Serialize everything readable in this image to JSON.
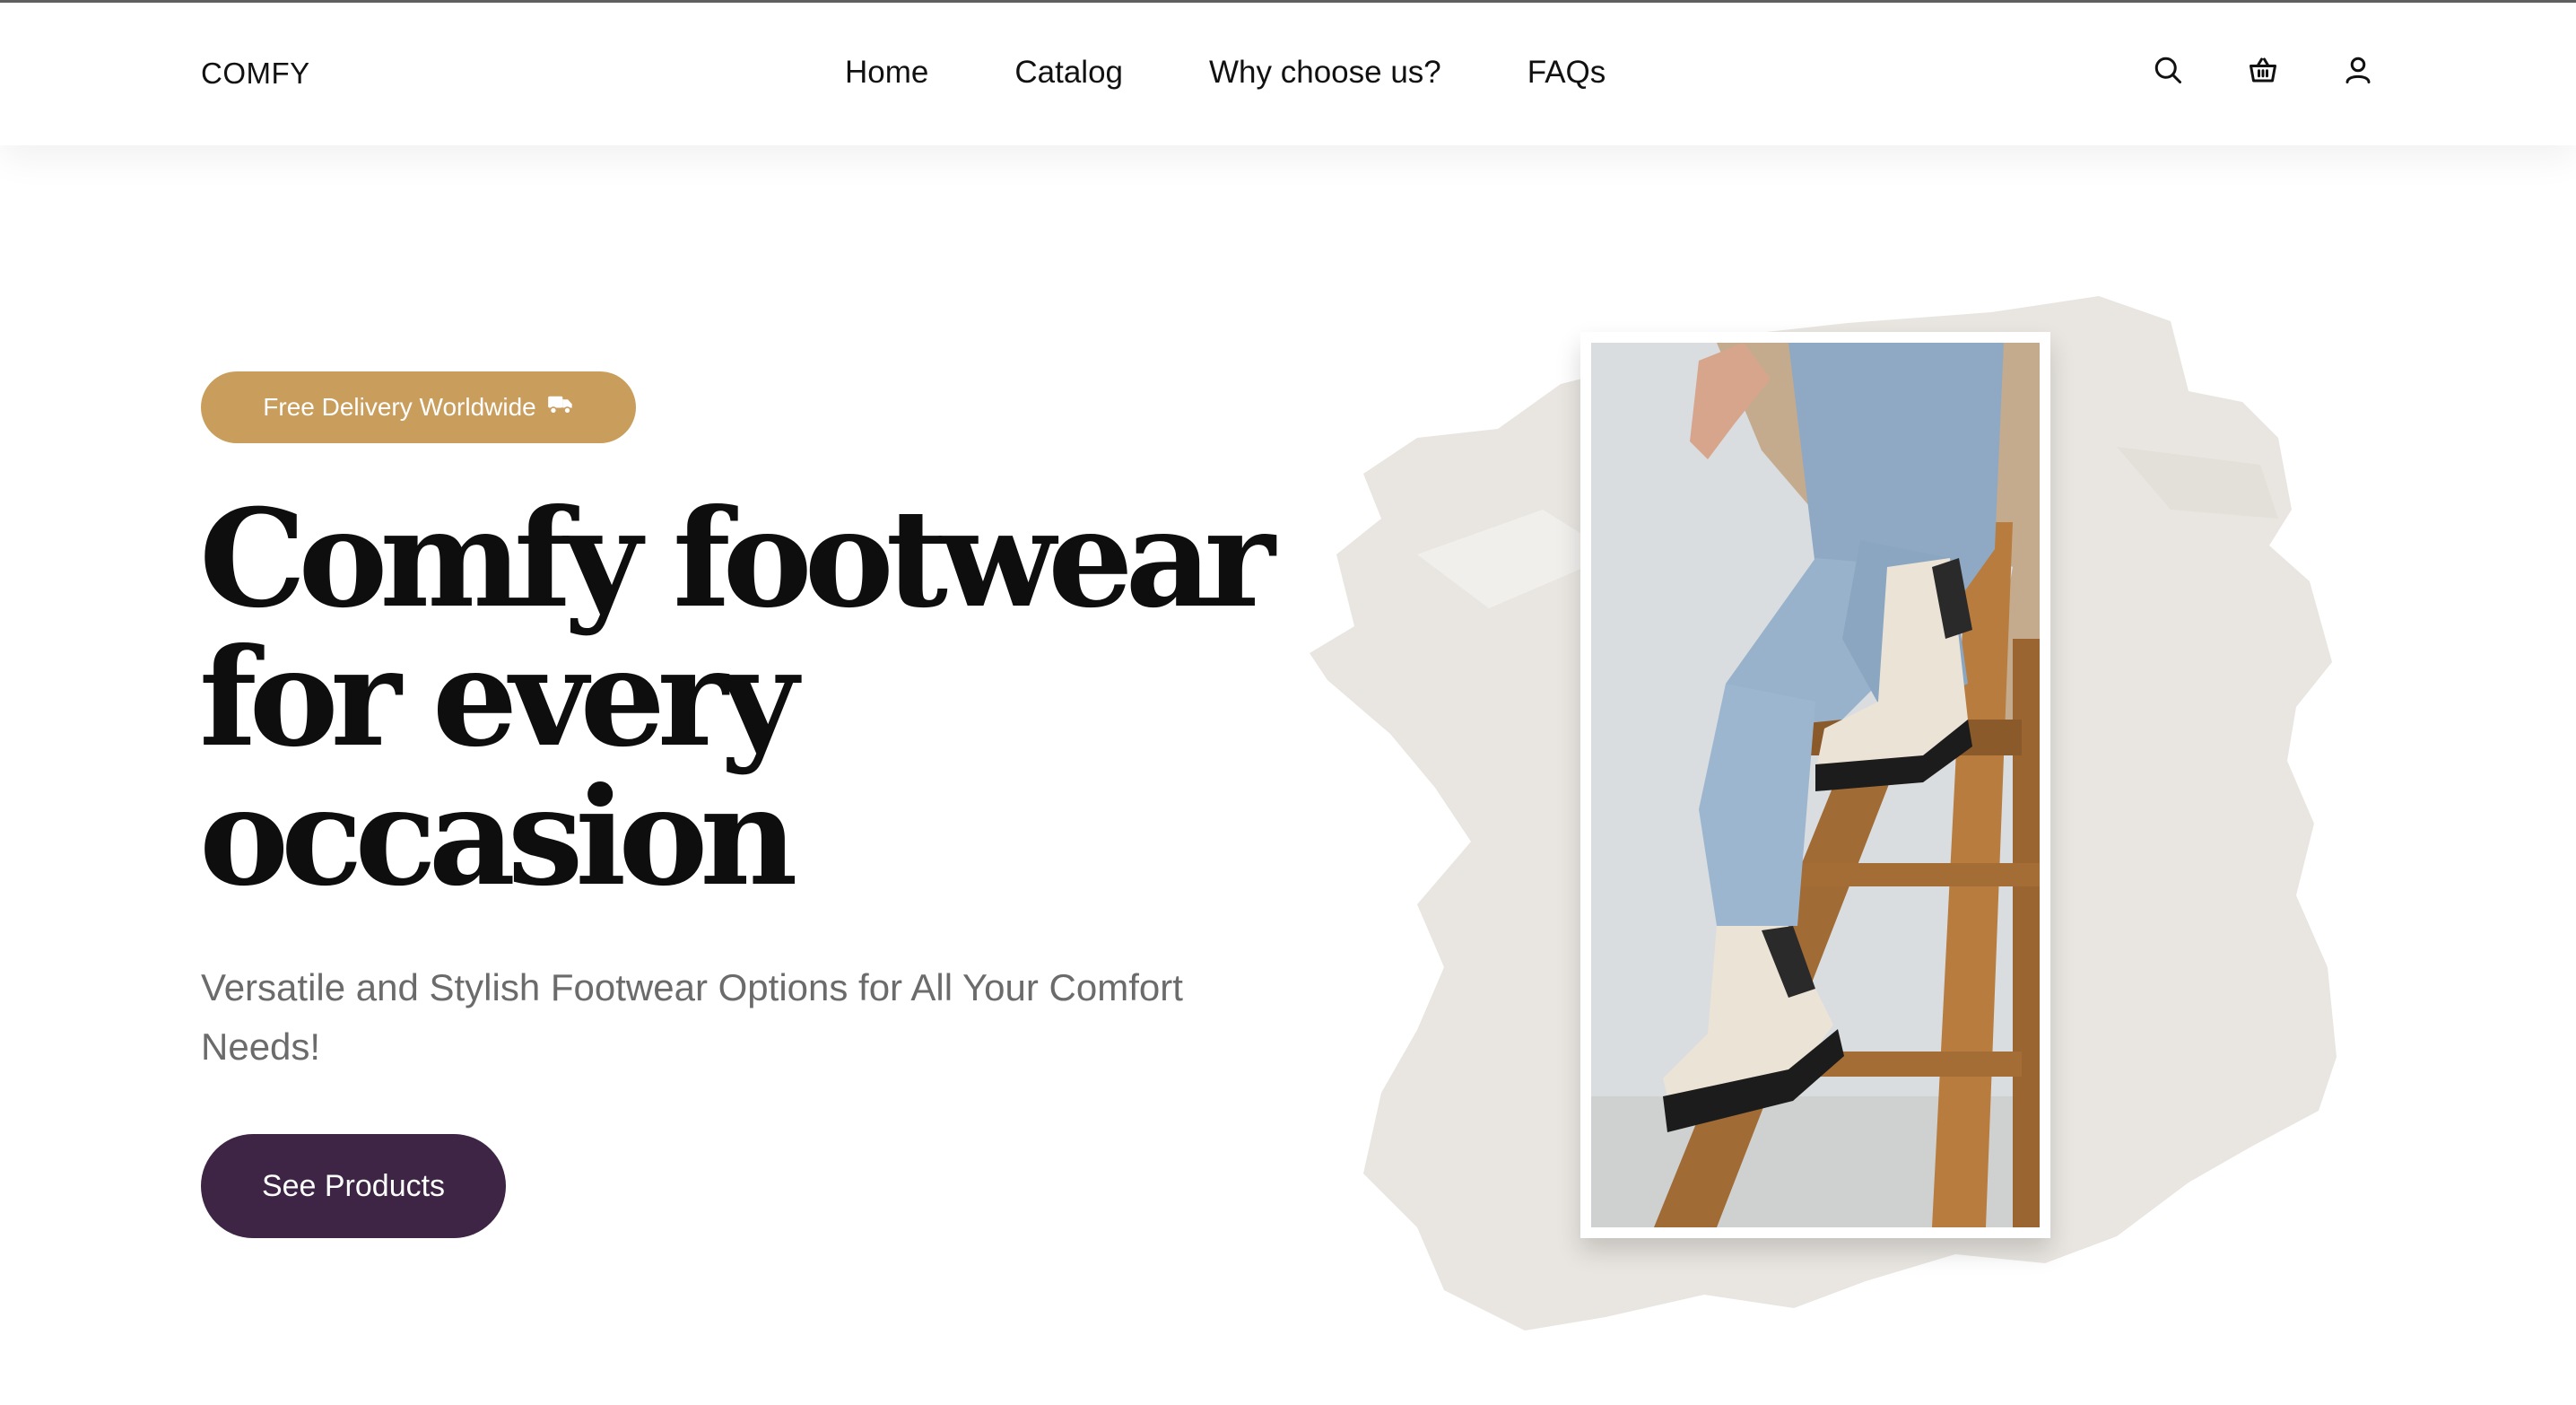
{
  "header": {
    "brand": "COMFY",
    "nav": [
      {
        "label": "Home"
      },
      {
        "label": "Catalog"
      },
      {
        "label": "Why choose us?"
      },
      {
        "label": "FAQs"
      }
    ],
    "icons": [
      "search-icon",
      "basket-icon",
      "user-icon"
    ]
  },
  "hero": {
    "badge": {
      "label": "Free Delivery Worldwide",
      "icon": "truck-icon"
    },
    "headline": [
      "Comfy footwear",
      "for every",
      "occasion"
    ],
    "subtitle": "Versatile and Stylish Footwear Options for All Your Comfort Needs!",
    "cta_label": "See Products"
  },
  "colors": {
    "accent_badge": "#c99d5c",
    "cta": "#3e2546",
    "brush": "#e9e6e1",
    "text": "#111111",
    "subtitle": "#6b6b6b"
  }
}
